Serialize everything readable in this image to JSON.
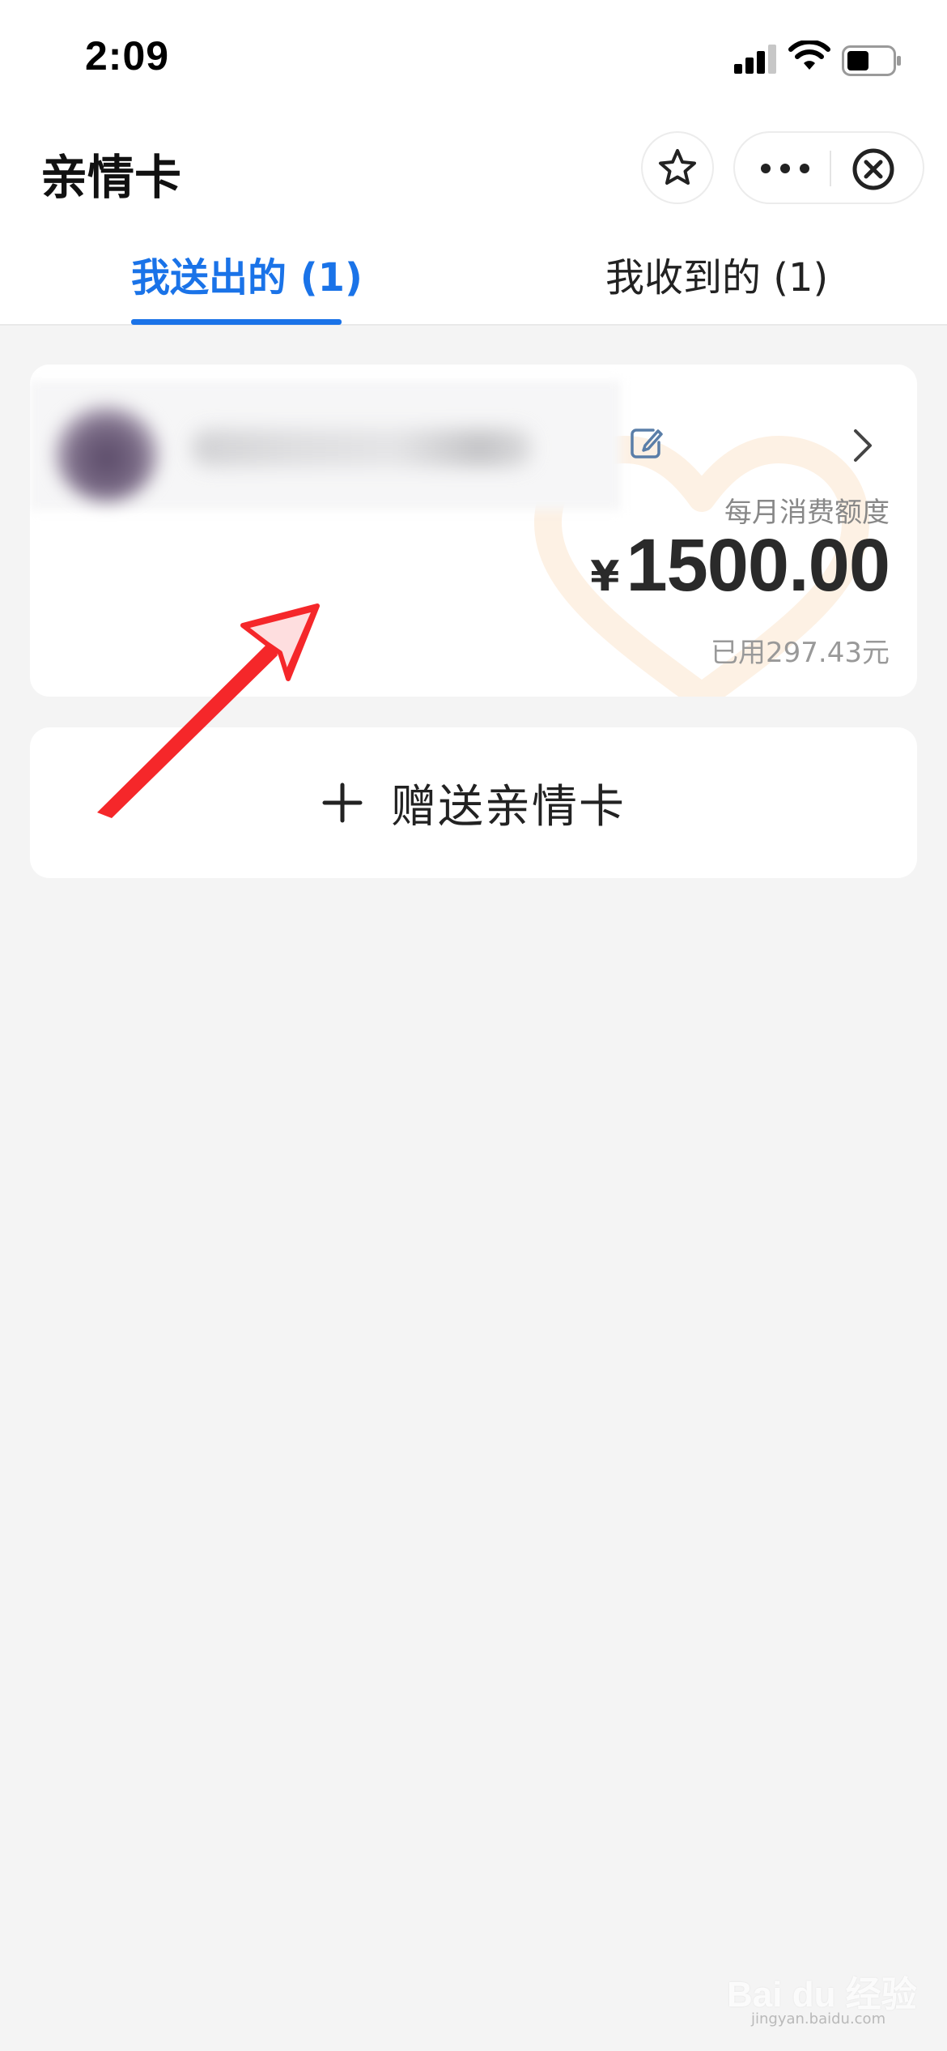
{
  "status_bar": {
    "time": "2:09",
    "icons": [
      "cellular-signal-icon",
      "wifi-icon",
      "battery-icon"
    ]
  },
  "header": {
    "title": "亲情卡",
    "favorite_icon": "star-icon",
    "more_icon": "more-dots-icon",
    "close_icon": "close-circle-icon"
  },
  "tabs": [
    {
      "label": "我送出的 (1)",
      "active": true
    },
    {
      "label": "我收到的 (1)",
      "active": false
    }
  ],
  "card": {
    "quota_label": "每月消费额度",
    "currency": "¥",
    "amount": "1500.00",
    "used": "已用297.43元",
    "edit_icon": "edit-icon",
    "chevron_icon": "chevron-right-icon"
  },
  "gift_button": {
    "label": "赠送亲情卡",
    "icon": "plus-icon"
  },
  "watermark": {
    "text": "Bai du 经验",
    "url": "jingyan.baidu.com"
  },
  "colors": {
    "accent": "#1a73e8",
    "background": "#f4f4f4",
    "annotation_arrow": "#f5272a"
  }
}
